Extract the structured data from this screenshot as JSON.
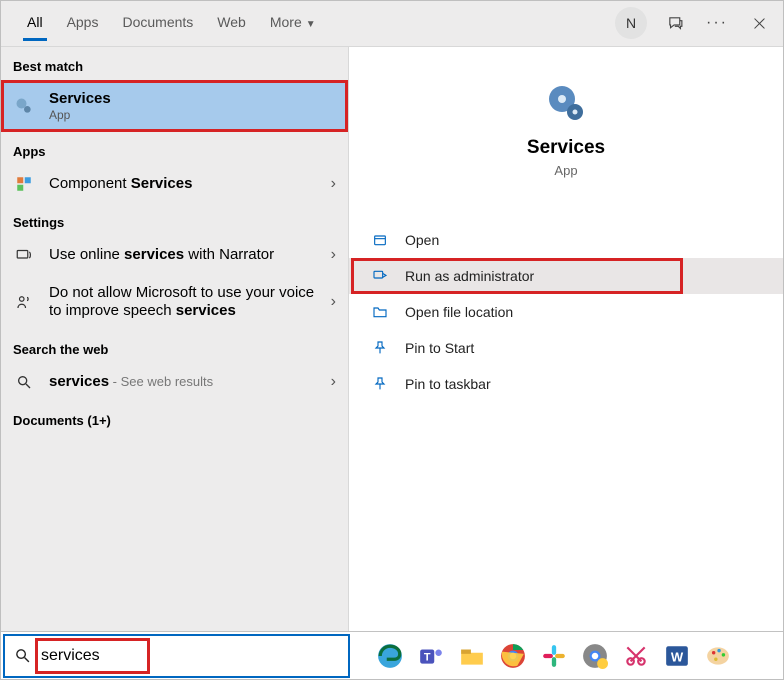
{
  "tabs": {
    "all": "All",
    "apps": "Apps",
    "documents": "Documents",
    "web": "Web",
    "more": "More"
  },
  "avatar_letter": "N",
  "sections": {
    "best_match": "Best match",
    "apps": "Apps",
    "settings": "Settings",
    "search_web": "Search the web",
    "documents": "Documents (1+)"
  },
  "results": {
    "services": {
      "title": "Services",
      "sub": "App"
    },
    "component_services": {
      "pre": "Component ",
      "kw": "Services"
    },
    "narrator": {
      "pre": "Use online ",
      "kw": "services",
      "post": " with Narrator"
    },
    "speech": {
      "pre": "Do not allow Microsoft to use your voice to improve speech ",
      "kw": "services"
    },
    "web": {
      "kw": "services",
      "sub": " - See web results"
    }
  },
  "preview": {
    "title": "Services",
    "sub": "App"
  },
  "actions": {
    "open": "Open",
    "run_admin": "Run as administrator",
    "open_loc": "Open file location",
    "pin_start": "Pin to Start",
    "pin_task": "Pin to taskbar"
  },
  "search_value": "services"
}
